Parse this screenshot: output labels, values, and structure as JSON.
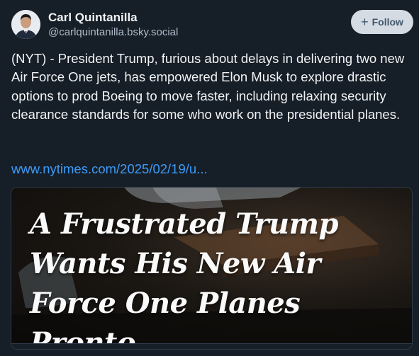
{
  "author": {
    "display_name": "Carl Quintanilla",
    "handle": "@carlquintanilla.bsky.social"
  },
  "follow_button": {
    "label": "Follow",
    "icon": "plus-icon"
  },
  "post": {
    "text": "(NYT) - President Trump, furious about delays in delivering two new Air Force One jets, has empowered Elon Musk to explore drastic options to prod Boeing to move faster, including relaxing security clearance standards for some who work on the presidential planes.",
    "link_text": "www.nytimes.com/2025/02/19/u..."
  },
  "embed": {
    "headline": [
      "A Frustrated Trump",
      "Wants His New Air",
      "Force One Planes Pronto"
    ]
  },
  "colors": {
    "background": "#161e27",
    "link": "#3d9bf7",
    "follow_bg": "#d4dbe2",
    "follow_text": "#42576c"
  }
}
